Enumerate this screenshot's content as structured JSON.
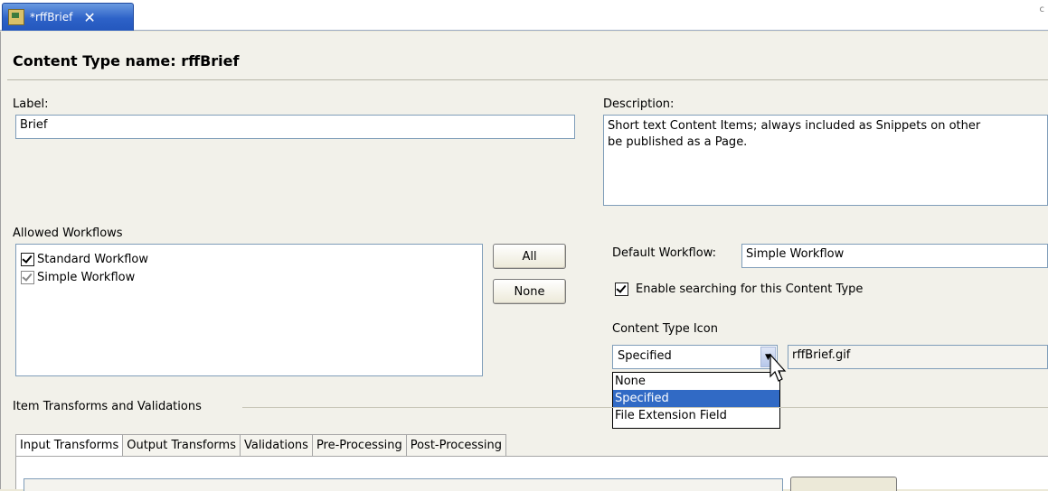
{
  "editor_tab": {
    "title": "*rffBrief",
    "close_glyph": "✕"
  },
  "corner_mark": "c",
  "page": {
    "title": "Content Type name: rffBrief"
  },
  "label_field": {
    "label": "Label:",
    "value": "Brief"
  },
  "description_field": {
    "label": "Description:",
    "line1": "Short text Content Items; always included as Snippets on other",
    "line2": "be published as a Page."
  },
  "allowed_workflows": {
    "label": "Allowed Workflows",
    "items": [
      {
        "label": "Standard Workflow",
        "checked": true
      },
      {
        "label": "Simple Workflow",
        "checked": true
      }
    ],
    "all_button": "All",
    "none_button": "None"
  },
  "default_workflow": {
    "label": "Default Workflow:",
    "value": "Simple Workflow"
  },
  "enable_search": {
    "label": "Enable searching for this Content Type",
    "checked": true
  },
  "content_type_icon": {
    "label": "Content Type Icon",
    "selected": "Specified",
    "filename": "rffBrief.gif",
    "options": [
      "None",
      "Specified",
      "File Extension Field"
    ]
  },
  "item_transforms": {
    "label": "Item Transforms and Validations",
    "tabs": [
      "Input Transforms",
      "Output Transforms",
      "Validations",
      "Pre-Processing",
      "Post-Processing"
    ]
  },
  "colors": {
    "tab_blue": "#2d62c8",
    "selection_blue": "#316ac5",
    "field_border": "#7f9db9"
  }
}
